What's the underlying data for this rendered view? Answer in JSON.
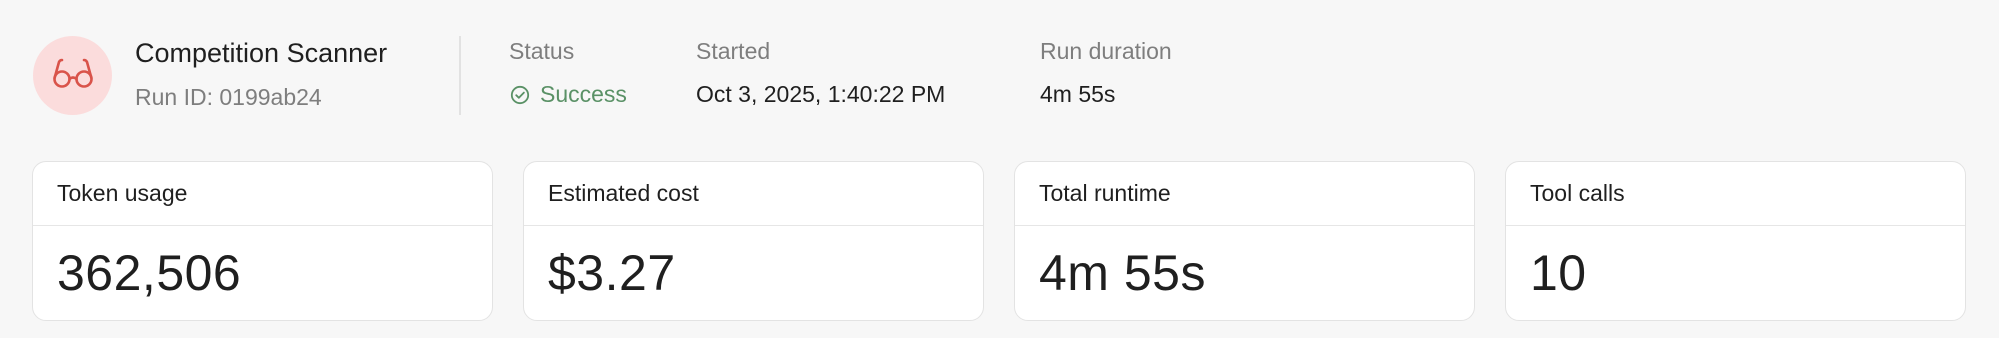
{
  "run": {
    "agent_name": "Competition Scanner",
    "run_id": "Run ID: 0199ab24",
    "avatar_icon": "glasses-icon",
    "avatar_color": "#fbdcdc",
    "icon_color": "#d9534a"
  },
  "meta": {
    "status_label": "Status",
    "status_value": "Success",
    "status_icon": "check-circle-icon",
    "status_color": "#5a9166",
    "started_label": "Started",
    "started_value": "Oct 3, 2025, 1:40:22 PM",
    "duration_label": "Run duration",
    "duration_value": "4m 55s"
  },
  "metrics": [
    {
      "label": "Token usage",
      "value": "362,506"
    },
    {
      "label": "Estimated cost",
      "value": "$3.27"
    },
    {
      "label": "Total runtime",
      "value": "4m 55s"
    },
    {
      "label": "Tool calls",
      "value": "10"
    }
  ]
}
